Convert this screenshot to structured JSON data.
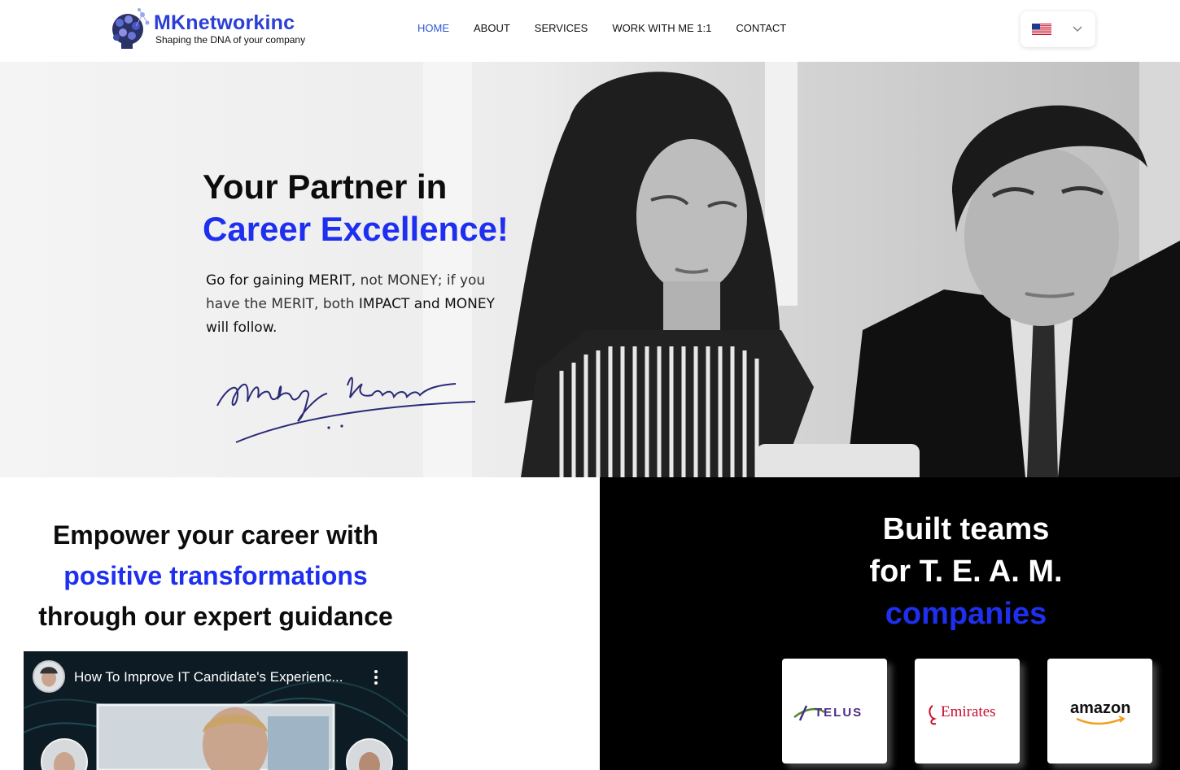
{
  "brand": {
    "name": "MKnetworkinc",
    "tagline": "Shaping the DNA of your company",
    "accent_color": "#1e2ff0"
  },
  "nav": {
    "items": [
      {
        "label": "HOME",
        "active": true
      },
      {
        "label": "ABOUT",
        "active": false
      },
      {
        "label": "SERVICES",
        "active": false
      },
      {
        "label": "WORK WITH ME 1:1",
        "active": false
      },
      {
        "label": "CONTACT",
        "active": false
      }
    ],
    "language_selector": {
      "flag_icon": "us-flag-icon",
      "chevron_icon": "chevron-down-icon"
    }
  },
  "hero": {
    "title_line1": "Your Partner in",
    "title_line2": "Career Excellence!",
    "quote_parts": {
      "p1": "Go for gaining MERIT,",
      "p2": " not MONEY; if you have the MERIT, both ",
      "p3": "IMPACT and MONEY will follow."
    },
    "signature": "Malay Kapoor"
  },
  "empower": {
    "line1": "Empower your career with",
    "line2": "positive transformations",
    "line3": "through our expert guidance"
  },
  "video": {
    "title": "How To Improve IT Candidate's Experienc...",
    "menu_icon": "more-vert-icon"
  },
  "teams": {
    "line1": "Built teams",
    "line2": "for T. E. A. M.",
    "line3": "companies",
    "companies": [
      "TELUS",
      "Emirates",
      "amazon"
    ]
  }
}
